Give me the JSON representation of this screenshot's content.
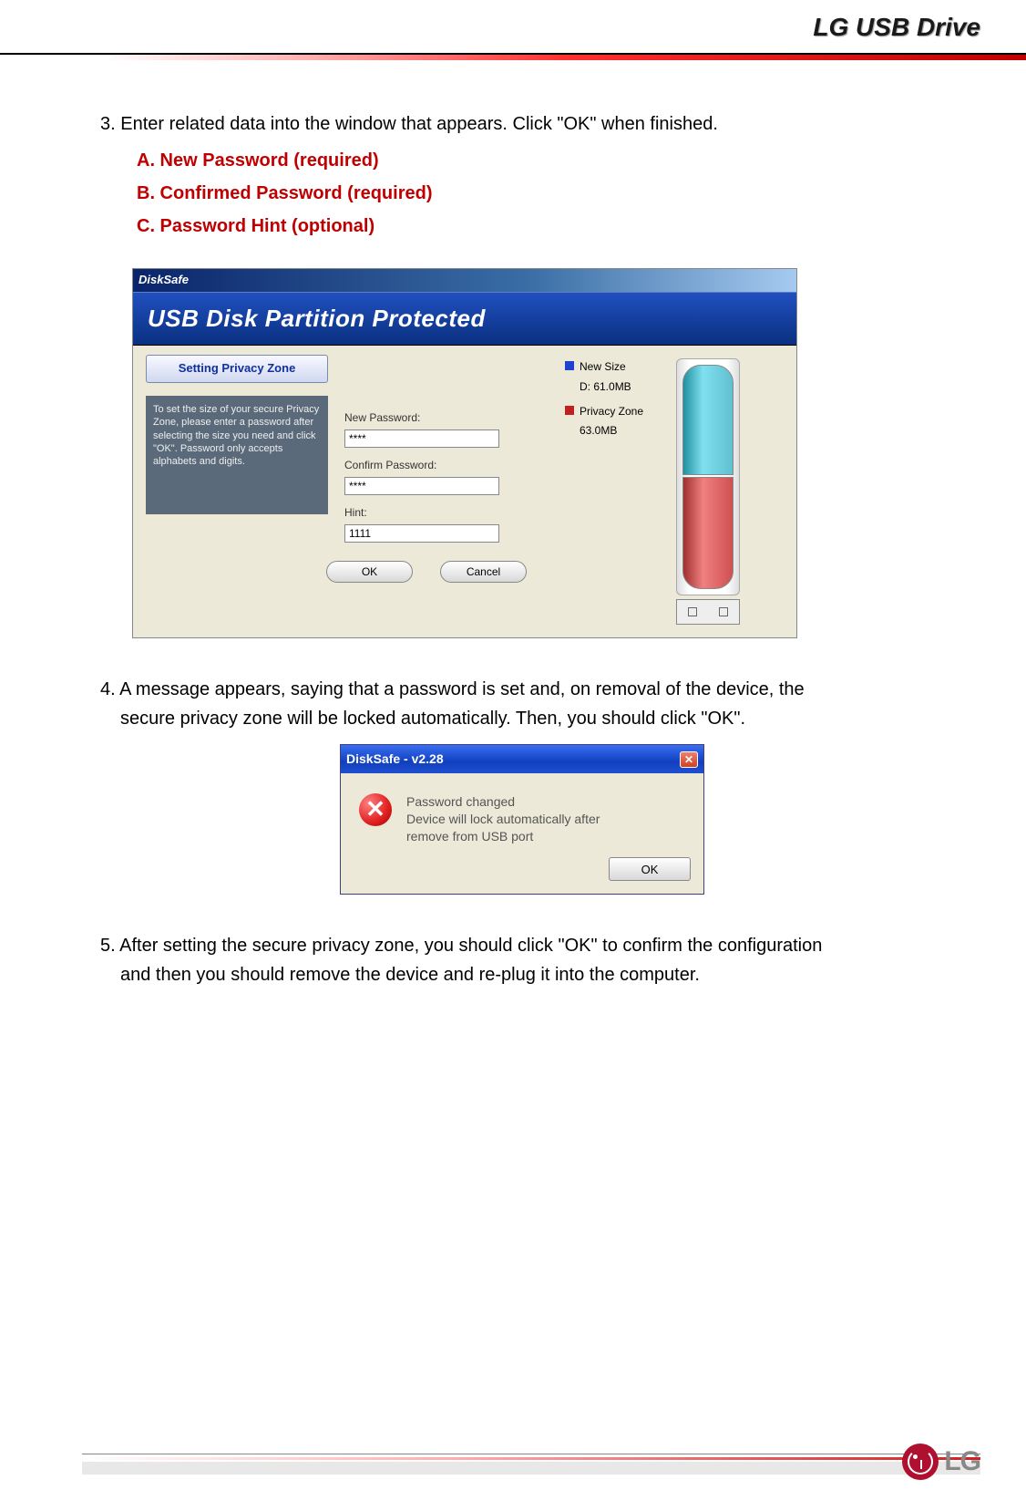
{
  "header": {
    "title": "LG USB Drive"
  },
  "step3": {
    "text": "3. Enter related data into the window that appears. Click \"OK\" when finished.",
    "a": "A. New Password (required)",
    "b": "B. Confirmed Password (required)",
    "c": "C. Password Hint (optional)"
  },
  "dialog1": {
    "titlebar": "DiskSafe",
    "banner": "USB Disk Partition Protected",
    "tab": "Setting Privacy Zone",
    "info": "To set the size of your secure Privacy Zone, please enter a password after selecting the size you need and click \"OK\". Password only accepts alphabets and digits.",
    "newpw_label": "New Password:",
    "newpw_value": "****",
    "confirm_label": "Confirm Password:",
    "confirm_value": "****",
    "hint_label": "Hint:",
    "hint_value": "1111",
    "ok": "OK",
    "cancel": "Cancel",
    "legend": {
      "newsize": "New Size",
      "newsize_val": "D: 61.0MB",
      "privacy": "Privacy Zone",
      "privacy_val": "63.0MB"
    }
  },
  "step4": {
    "line1": "4. A message appears, saying that a password is set and, on removal of the device, the",
    "line2": "secure privacy zone will be locked automatically. Then, you should click \"OK\"."
  },
  "dialog2": {
    "titlebar": "DiskSafe - v2.28",
    "msg_l1": "Password changed",
    "msg_l2": "Device will lock automatically after",
    "msg_l3": "remove from USB port",
    "ok": "OK"
  },
  "step5": {
    "line1": "5. After setting the secure privacy zone, you should click \"OK\" to confirm the configuration",
    "line2": "and then you should remove the device and re-plug it into the computer."
  },
  "footer": {
    "logo_text": "LG"
  }
}
